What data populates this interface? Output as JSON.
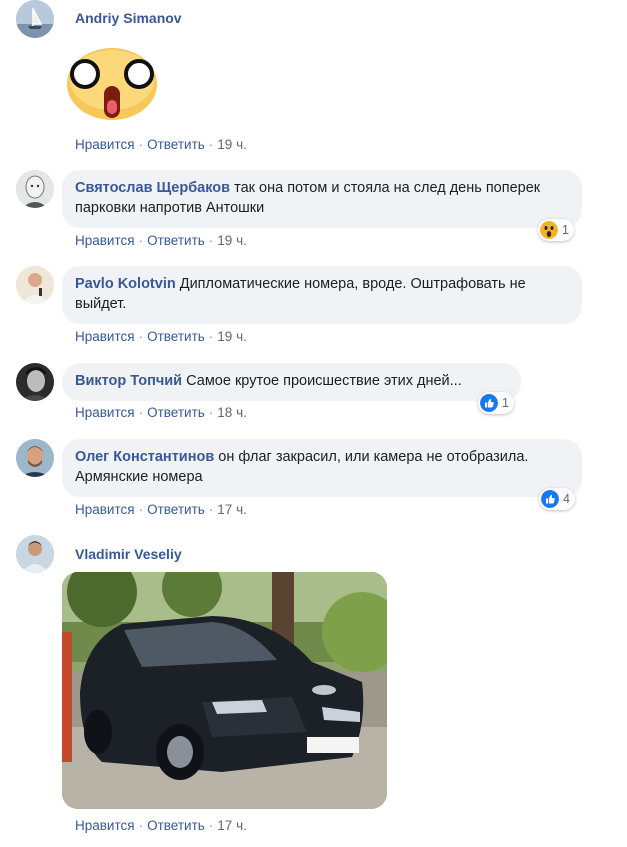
{
  "action_labels": {
    "like": "Нравится",
    "reply": "Ответить",
    "separator": "·"
  },
  "comments": [
    {
      "author": "Andriy Simanov",
      "text": "",
      "time": "19 ч.",
      "sticker": "surprised-face-sticker"
    },
    {
      "author": "Святослав Щербаков",
      "text": "так она потом и стояла на след день поперек парковки напротив Антошки",
      "time": "19 ч.",
      "reaction": {
        "type": "wow",
        "count": "1"
      }
    },
    {
      "author": "Pavlo Kolotvin",
      "text": "Дипломатические номера, вроде. Оштрафовать не выйдет.",
      "time": "19 ч."
    },
    {
      "author": "Виктор Топчий",
      "text": "Самое крутое происшествие этих дней...",
      "time": "18 ч.",
      "reaction": {
        "type": "like",
        "count": "1"
      }
    },
    {
      "author": "Олег Константинов",
      "text": "он флаг закрасил, или камера не отобразила. Армянские номера",
      "time": "17 ч.",
      "reaction": {
        "type": "like",
        "count": "4"
      }
    },
    {
      "author": "Vladimir Veseliy",
      "text": "",
      "time": "17 ч.",
      "attachment": "car-photo"
    }
  ],
  "colors": {
    "link": "#385898",
    "bubble": "#f0f2f5",
    "like": "#1877f2",
    "wow": "#f7b125"
  }
}
